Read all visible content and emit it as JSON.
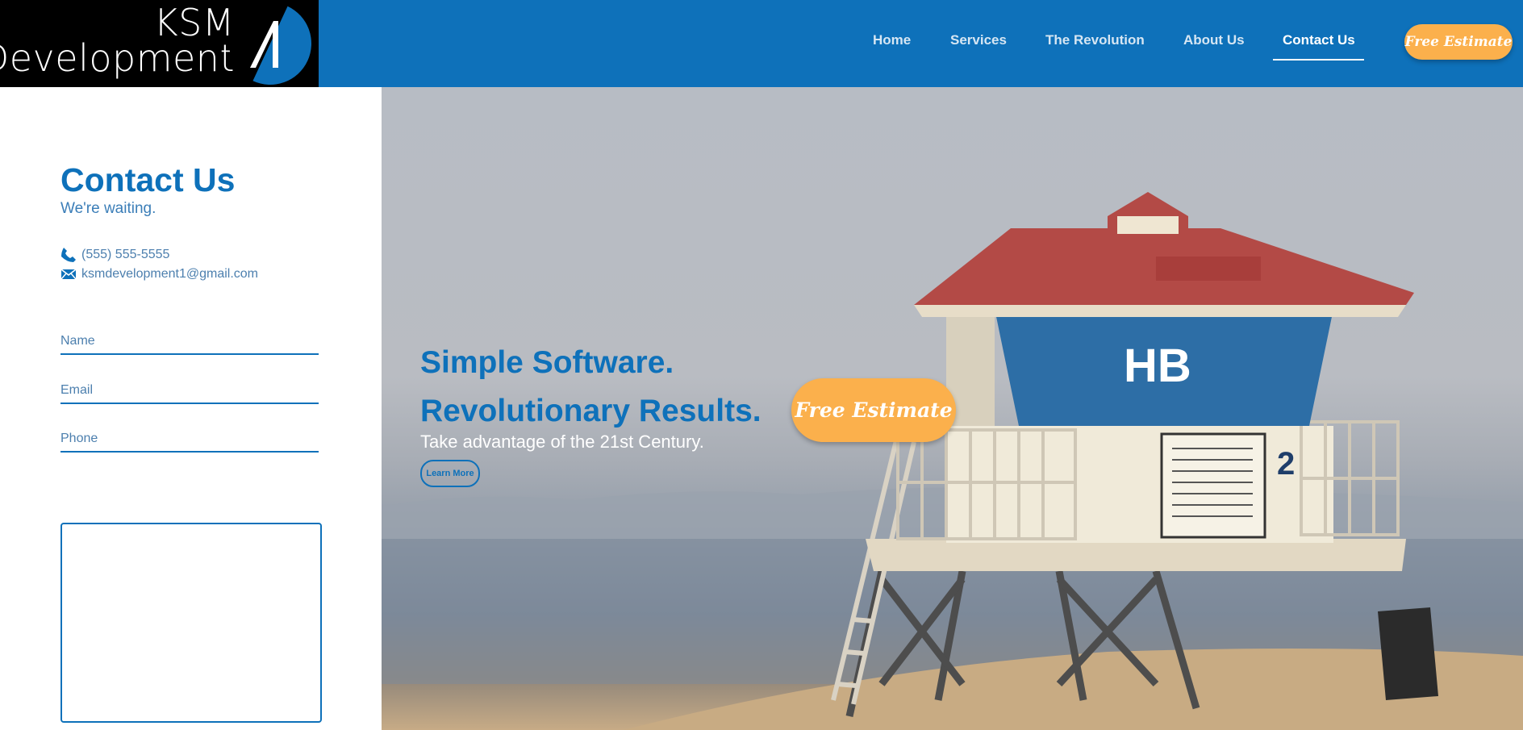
{
  "header": {
    "logo_line1": "KSM",
    "logo_line2": "Development",
    "nav": [
      "Home",
      "Services",
      "The Revolution",
      "About Us",
      "Contact Us"
    ],
    "active_nav": "Contact Us",
    "cta_label": "Free Estimate"
  },
  "contact": {
    "title": "Contact Us",
    "subtitle": "We're waiting.",
    "phone": "(555) 555-5555",
    "email": "ksmdevelopment1@gmail.com",
    "name_placeholder": "Name",
    "email_placeholder": "Email",
    "phone_placeholder": "Phone",
    "message_value": ""
  },
  "hero": {
    "title_line1": "Simple Software.",
    "title_line2": "Revolutionary Results.",
    "subtitle": "Take advantage of the 21st Century.",
    "learn_more": "Learn More",
    "cta_label": "Free Estimate",
    "tower_number": "2",
    "tower_banner": "HB"
  },
  "colors": {
    "brand_blue": "#0e71ba",
    "accent_orange": "#fbb04c",
    "logo_bg": "#000000"
  }
}
